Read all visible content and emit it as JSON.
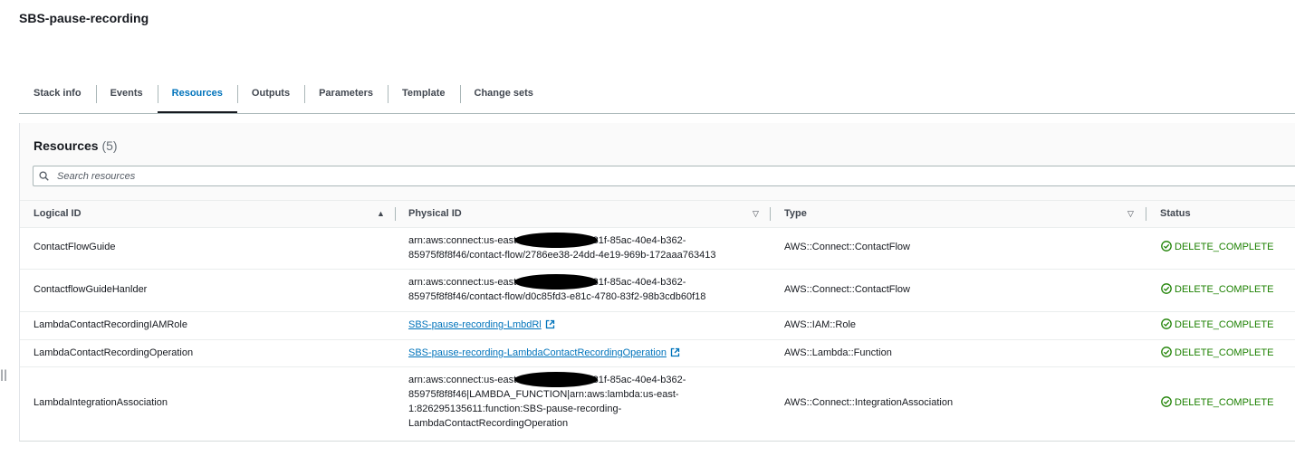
{
  "stack": {
    "title": "SBS-pause-recording"
  },
  "tabs": [
    {
      "label": "Stack info"
    },
    {
      "label": "Events"
    },
    {
      "label": "Resources",
      "active": true
    },
    {
      "label": "Outputs"
    },
    {
      "label": "Parameters"
    },
    {
      "label": "Template"
    },
    {
      "label": "Change sets"
    }
  ],
  "resources": {
    "title": "Resources",
    "count": "(5)",
    "search_placeholder": "Search resources",
    "columns": {
      "logical_id": "Logical ID",
      "physical_id": "Physical ID",
      "type": "Type",
      "status": "Status"
    },
    "rows": [
      {
        "logical_id": "ContactFlowGuide",
        "physical_id": "arn:aws:connect:us-east-1               nstance/aece831f-85ac-40e4-b362-\n85975f8f8f46/contact-flow/2786ee38-24dd-4e19-969b-172aaa763413",
        "type": "AWS::Connect::ContactFlow",
        "status": "DELETE_COMPLETE"
      },
      {
        "logical_id": "ContactflowGuideHanlder",
        "physical_id": "arn:aws:connect:us-east-1               nstance/aece831f-85ac-40e4-b362-\n85975f8f8f46/contact-flow/d0c85fd3-e81c-4780-83f2-98b3cdb60f18",
        "type": "AWS::Connect::ContactFlow",
        "status": "DELETE_COMPLETE"
      },
      {
        "logical_id": "LambdaContactRecordingIAMRole",
        "physical_id": "SBS-pause-recording-LmbdRl",
        "type": "AWS::IAM::Role",
        "status": "DELETE_COMPLETE"
      },
      {
        "logical_id": "LambdaContactRecordingOperation",
        "physical_id": "SBS-pause-recording-LambdaContactRecordingOperation",
        "type": "AWS::Lambda::Function",
        "status": "DELETE_COMPLETE"
      },
      {
        "logical_id": "LambdaIntegrationAssociation",
        "physical_id": "arn:aws:connect:us-east-1               nstance/aece831f-85ac-40e4-b362-\n85975f8f8f46|LAMBDA_FUNCTION|arn:aws:lambda:us-east-\n1:826295135611:function:SBS-pause-recording-\nLambdaContactRecordingOperation",
        "type": "AWS::Connect::IntegrationAssociation",
        "status": "DELETE_COMPLETE"
      }
    ]
  },
  "colors": {
    "link": "#0073bb",
    "status_success": "#1d8102",
    "redaction": "#000000"
  },
  "icons": [
    "search-icon",
    "sort-ascending-icon",
    "sort-descending-icon",
    "external-link-icon",
    "status-success-icon",
    "drag-handle-icon"
  ]
}
